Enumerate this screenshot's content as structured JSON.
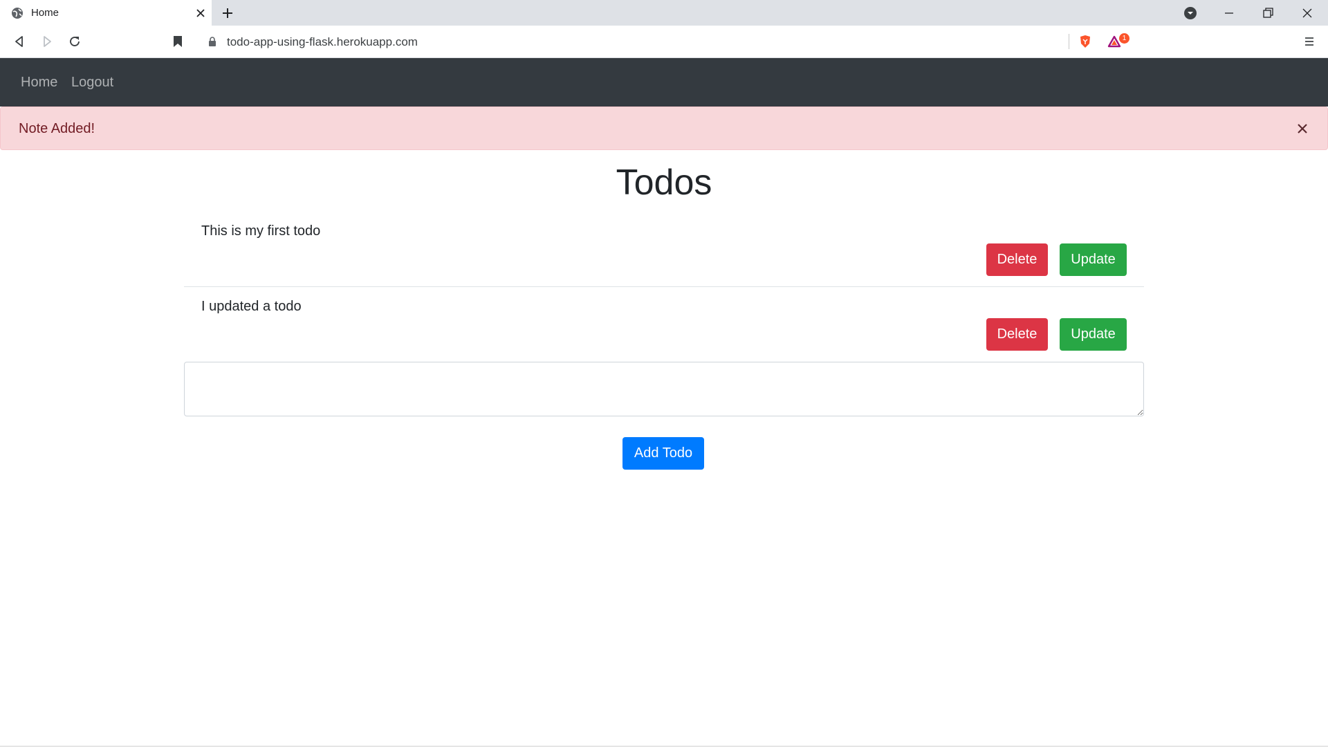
{
  "browser": {
    "tab_title": "Home",
    "url": "todo-app-using-flask.herokuapp.com",
    "notification_count": "1"
  },
  "navbar": {
    "links": [
      {
        "label": "Home"
      },
      {
        "label": "Logout"
      }
    ]
  },
  "alert": {
    "message": "Note Added!",
    "close_symbol": "×"
  },
  "main": {
    "title": "Todos",
    "todos": [
      {
        "text": "This is my first todo",
        "delete_label": "Delete",
        "update_label": "Update"
      },
      {
        "text": "I updated a todo",
        "delete_label": "Delete",
        "update_label": "Update"
      }
    ],
    "input_value": "",
    "add_label": "Add Todo"
  },
  "colors": {
    "navbar": "#343a40",
    "alert_bg": "#f8d7da",
    "danger": "#dc3545",
    "success": "#28a745",
    "primary": "#007bff"
  },
  "icons": {
    "tab": [
      "globe-icon",
      "close-icon"
    ],
    "toolbar": [
      "back-icon",
      "forward-icon",
      "reload-icon",
      "bookmark-icon",
      "lock-icon",
      "brave-shield-icon",
      "brave-rewards-icon",
      "menu-icon"
    ],
    "window": [
      "profile-dropdown-icon",
      "minimize-icon",
      "restore-icon",
      "window-close-icon"
    ]
  }
}
